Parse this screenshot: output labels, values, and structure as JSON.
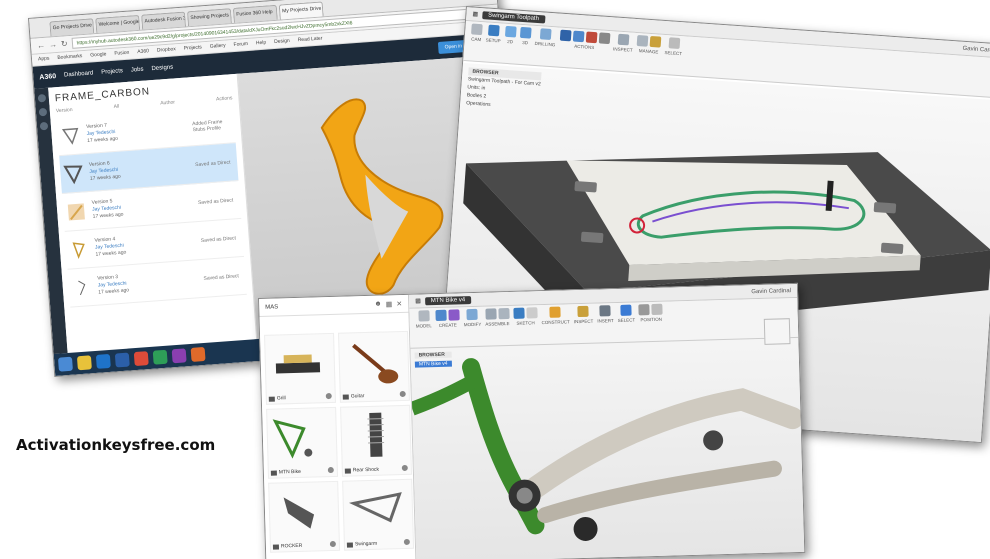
{
  "browser": {
    "tabs": [
      "Go Projects Drive - Win",
      "Welcome | Google Docs",
      "Autodesk Fusion 360",
      "Showing Projects",
      "Fusion 360 Help",
      "My Projects Drive - My Tab"
    ],
    "active_tab": 5,
    "url": "https://myhub.autodesk360.com/ue29c9d2/g/projects/201409016341453/data/dXJuOmFkc2sud2lwcHJvZDpmcy5mb2xkZXI6",
    "bookmarks": [
      "Apps",
      "Bookmarks",
      "Google",
      "Fusion",
      "A360",
      "Dropbox",
      "Projects",
      "Gallery",
      "Forum",
      "Help",
      "Design",
      "Read Later"
    ],
    "a360_logo": "A360",
    "a360_nav": [
      "Dashboard",
      "Projects",
      "Jobs",
      "Designs"
    ],
    "open_fusion_label": "Open in Fusion 360",
    "project_title": "FRAME_CARBON",
    "sort_label": "All",
    "col_version": "Version",
    "col_author": "Author",
    "col_actions": "Actions",
    "versions": [
      {
        "label": "Version 7",
        "author": "Jay Tedeschi",
        "time": "17 weeks ago",
        "action": "Added Frame Stubs Profile"
      },
      {
        "label": "Version 6",
        "author": "Jay Tedeschi",
        "time": "17 weeks ago",
        "action": "Saved as Direct"
      },
      {
        "label": "Version 5",
        "author": "Jay Tedeschi",
        "time": "17 weeks ago",
        "action": "Saved as Direct"
      },
      {
        "label": "Version 4",
        "author": "Jay Tedeschi",
        "time": "17 weeks ago",
        "action": "Saved as Direct"
      },
      {
        "label": "Version 3",
        "author": "Jay Tedeschi",
        "time": "17 weeks ago",
        "action": "Saved as Direct"
      }
    ]
  },
  "cam": {
    "doc_title": "Swingarm Toolpath",
    "user": "Gavin Cardinal",
    "workspace": "CAM",
    "ribbon_groups": [
      "SETUP",
      "2D",
      "3D",
      "DRILLING",
      "ACTIONS",
      "INSPECT",
      "MANAGE",
      "SELECT"
    ],
    "browser_title": "BROWSER",
    "tree": [
      "Swingarm Toolpath - For Cam v2",
      "Units: in",
      "Bodies 2",
      "Operations"
    ]
  },
  "fusion": {
    "panel_title": "MAS",
    "doc_title": "MTN Bike v4",
    "user": "Gavin Cardinal",
    "workspace": "MODEL",
    "ribbon_groups": [
      "CREATE",
      "MODIFY",
      "ASSEMBLE",
      "SKETCH",
      "CONSTRUCT",
      "INSPECT",
      "INSERT",
      "SELECT",
      "POSITION"
    ],
    "browser_title": "BROWSER",
    "browser_item": "MTN Bike v4",
    "cards": [
      "Grill",
      "Guitar",
      "MTN Bike",
      "Rear Shock",
      "ROCKER",
      "Swingarm"
    ]
  },
  "watermark": "Activationkeysfree.com",
  "colors": {
    "part_orange": "#f2a515",
    "frame_green": "#3c8a2c",
    "accent_blue": "#3b8fd9"
  }
}
